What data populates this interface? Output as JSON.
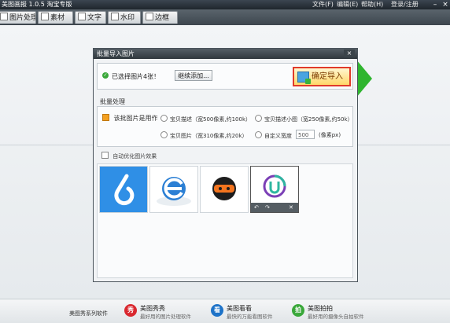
{
  "app": {
    "title": "美图画报 1.0.5 淘宝专版"
  },
  "menu": {
    "file": "文件(F)",
    "edit": "编辑(E)",
    "help": "帮助(H)",
    "login": "登录/注册"
  },
  "tabs": [
    {
      "label": "图片处理",
      "icon": "image-icon"
    },
    {
      "label": "素材",
      "icon": "material-icon"
    },
    {
      "label": "文字",
      "icon": "text-icon"
    },
    {
      "label": "水印",
      "icon": "watermark-icon"
    },
    {
      "label": "边框",
      "icon": "frame-icon"
    }
  ],
  "dialog": {
    "title": "批量导入图片",
    "close": "×",
    "selected_text": "已选择图片4张！",
    "continue_btn": "继续添加...",
    "confirm_btn": "确定导入",
    "batch_section": "批量处理",
    "batch_checkbox": "该批图片是用作",
    "options": [
      "宝贝描述（宽500像素,约100k）",
      "宝贝描述小图（宽250像素,约50k）",
      "宝贝图片（宽310像素,约20k）",
      "自定义宽度"
    ],
    "custom_width": "500",
    "unit": "(像素px)",
    "auto_optimize": "自动优化图片效果",
    "thumb_tools": [
      "↶",
      "↷",
      "✕"
    ]
  },
  "bottom": {
    "series": "美图秀系列软件",
    "products": [
      {
        "name": "美图秀秀",
        "desc": "最好用的图片处理软件",
        "icon": "秀",
        "color": "#d9282f"
      },
      {
        "name": "美图看看",
        "desc": "最快的万能看图软件",
        "icon": "看",
        "color": "#1e73c8"
      },
      {
        "name": "美图拍拍",
        "desc": "最好用的摄像头自拍软件",
        "icon": "拍",
        "color": "#3aa83a"
      }
    ]
  }
}
